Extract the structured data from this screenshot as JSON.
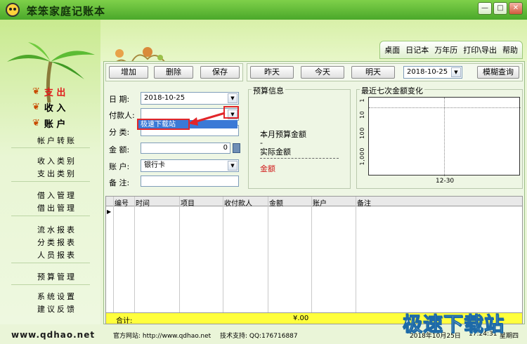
{
  "app": {
    "title": "笨笨家庭记账本"
  },
  "window_controls": [
    "—",
    "□",
    "✕"
  ],
  "top_menu": [
    "桌面",
    "日记本",
    "万年历",
    "打印\\导出",
    "帮助"
  ],
  "sidebar": {
    "main": [
      {
        "label": "支 出",
        "color": "#e01b1b"
      },
      {
        "label": "收 入",
        "color": "#000000"
      },
      {
        "label": "账 户",
        "color": "#000000"
      }
    ],
    "transfer": "帐户转账",
    "groups": [
      [
        "收入类别",
        "支出类别"
      ],
      [
        "借入管理",
        "借出管理"
      ],
      [
        "流水报表",
        "分类报表",
        "人员报表"
      ],
      [
        "预算管理"
      ],
      [
        "系统设置",
        "建议反馈"
      ]
    ],
    "website": "www.qdhao.net"
  },
  "toolbar": {
    "add": "增加",
    "delete": "删除",
    "save": "保存",
    "prev_day": "昨天",
    "today": "今天",
    "next_day": "明天",
    "date": "2018-10-25",
    "fuzzy_search": "模糊查询"
  },
  "form": {
    "date_label": "日  期:",
    "date_value": "2018-10-25",
    "payee_label": "付款人:",
    "payee_value": "",
    "category_label": "分  类:",
    "category_value": "",
    "amount_label": "金  额:",
    "amount_value": "0",
    "account_label": "账  户:",
    "account_value": "银行卡",
    "note_label": "备  注:",
    "note_value": ""
  },
  "dropdown": {
    "option": "极速下载站"
  },
  "budget": {
    "title": "预算信息",
    "month_budget_label": "本月预算金额",
    "month_budget_value": "-",
    "actual_label": "实际金额",
    "actual_value": "-",
    "amount_label": "金额"
  },
  "chart": {
    "title": "最近七次金额变化",
    "y_ticks": [
      "1,000",
      "100",
      "10",
      "1"
    ],
    "x_tick": "12-30"
  },
  "chart_data": {
    "type": "line",
    "title": "最近七次金额变化",
    "x": [
      "12-30"
    ],
    "y_axis_scale": "log",
    "y_ticks": [
      1,
      10,
      100,
      1000
    ],
    "series": []
  },
  "grid": {
    "columns": [
      "编号",
      "时间",
      "项目",
      "收付款人",
      "金额",
      "账户",
      "备注"
    ],
    "total_label": "合计:",
    "total_amount": "¥.00"
  },
  "status": {
    "website": "官方网站: http://www.qdhao.net",
    "support": "技术支持: QQ:176716887",
    "datetime": "2018年10月25日",
    "time": "17:24:31",
    "weekday": "星期四"
  },
  "watermark": "极速下载站"
}
